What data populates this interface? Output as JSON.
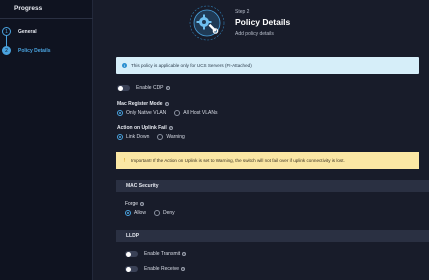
{
  "sidebar": {
    "title": "Progress",
    "steps": [
      {
        "num": "1",
        "label": "General"
      },
      {
        "num": "2",
        "label": "Policy Details"
      }
    ]
  },
  "header": {
    "step_label": "Step 2",
    "title": "Policy Details",
    "subtitle": "Add policy details"
  },
  "info_banner": {
    "icon": "i",
    "text": "This policy is applicable only for UCS Servers (FI-Attached)"
  },
  "enable_cdp": {
    "label": "Enable CDP",
    "on": false
  },
  "mac_register_mode": {
    "label": "Mac Register Mode",
    "options": [
      "Only Native VLAN",
      "All Host VLANs"
    ],
    "selected": "Only Native VLAN"
  },
  "action_on_uplink_fail": {
    "label": "Action on Uplink Fail",
    "options": [
      "Link Down",
      "Warning"
    ],
    "selected": "Link Down"
  },
  "warning_banner": {
    "icon": "!",
    "text": "Important! If the Action on Uplink is set to Warning, the switch will not fail over if uplink connectivity is lost."
  },
  "mac_security": {
    "title": "MAC Security",
    "forge": {
      "label": "Forge",
      "options": [
        "Allow",
        "Deny"
      ],
      "selected": "Allow"
    }
  },
  "lldp": {
    "title": "LLDP",
    "enable_transmit": {
      "label": "Enable Transmit",
      "on": false
    },
    "enable_receive": {
      "label": "Enable Receive",
      "on": false
    }
  },
  "colors": {
    "accent": "#4aa3df",
    "info_bg": "#d6eef9",
    "warning_bg": "#fbe7a4"
  }
}
